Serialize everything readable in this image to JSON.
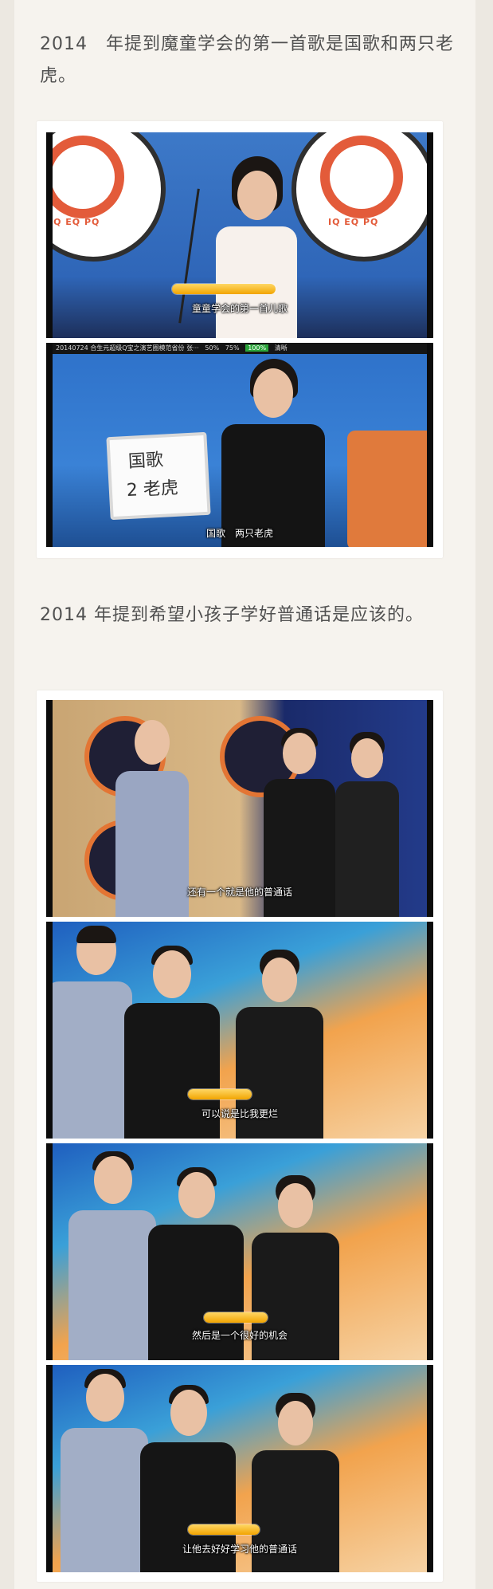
{
  "sections": [
    {
      "text": "2014　年提到魔童学会的第一首歌是国歌和两只老虎。",
      "frames": [
        {
          "caption": "童童学会的第一首儿歌",
          "logo": "IQ EQ PQ"
        },
        {
          "ticker": "20140724 合生元超级Q宝之演艺圈模范省份 张···",
          "ticker_stats": [
            "50%",
            "75%",
            "100%",
            "清晰"
          ],
          "board_text_line1": "国歌",
          "board_text_line2": "2 老虎",
          "caption": "国歌　两只老虎"
        }
      ]
    },
    {
      "text": "2014 年提到希望小孩子学好普通话是应该的。",
      "frames": [
        {
          "caption": "还有一个就是他的普通话"
        },
        {
          "caption": "可以说是比我更烂"
        },
        {
          "caption": "然后是一个很好的机会"
        },
        {
          "caption": "让他去好好学习他的普通话"
        }
      ]
    }
  ]
}
